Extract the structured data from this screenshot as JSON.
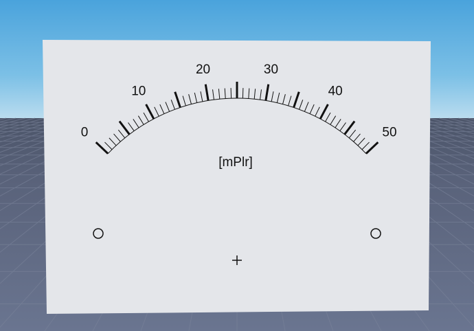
{
  "gauge": {
    "unit_label": "[mPlr]",
    "min": 0,
    "max": 50,
    "major_step": 10,
    "mid_step": 5,
    "minor_step": 1,
    "tick_labels": [
      "0",
      "10",
      "20",
      "30",
      "40",
      "50"
    ]
  },
  "colors": {
    "panel": "#e4e6ea",
    "ink": "#111111"
  }
}
